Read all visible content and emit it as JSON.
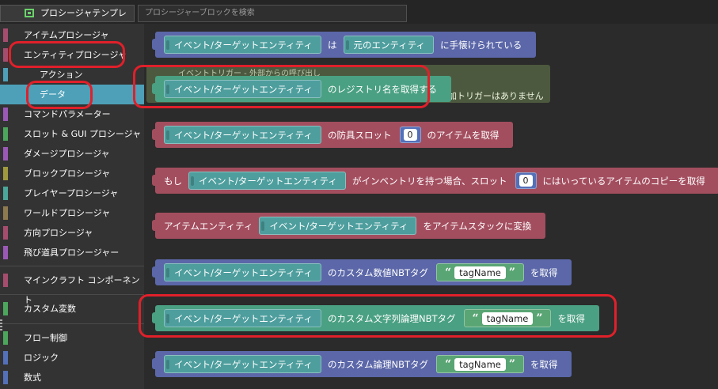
{
  "header": {
    "tab_label": "プロシージャテンプレート",
    "search_placeholder": "プロシージャーブロックを検索"
  },
  "sidebar": {
    "items": [
      {
        "label": "アイテムプロシージャ",
        "color": "#a64d6e"
      },
      {
        "label": "エンティティプロシージャ",
        "color": "#a64d6e"
      },
      {
        "label": "アクション",
        "color": "#4da0b8"
      },
      {
        "label": "データ",
        "color": "#4da0b8"
      },
      {
        "label": "コマンドパラメーター",
        "color": "#9b59b6"
      },
      {
        "label": "スロット & GUI プロシージャ",
        "color": "#4ca65c"
      },
      {
        "label": "ダメージプロシージャ",
        "color": "#9b59b6"
      },
      {
        "label": "ブロックプロシージャ",
        "color": "#9f9a3d"
      },
      {
        "label": "プレイヤープロシージャ",
        "color": "#4aa79a"
      },
      {
        "label": "ワールドプロシージャ",
        "color": "#8e7a4f"
      },
      {
        "label": "方向プロシージャ",
        "color": "#a64d6e"
      },
      {
        "label": "飛び道具プロシージャー",
        "color": "#9b59b6"
      },
      {
        "label": "マインクラフト コンポーネント",
        "color": "#a64d6e"
      },
      {
        "label": "カスタム変数",
        "color": "#4ca65c"
      },
      {
        "label": "フロー制御",
        "color": "#4ca65c"
      },
      {
        "label": "ロジック",
        "color": "#5470b8"
      },
      {
        "label": "数式",
        "color": "#5470b8"
      }
    ]
  },
  "workspace": {
    "ghost_text": "イベントトリガー - 外部からの呼び出し",
    "ghost_trailing": "追加トリガーはありません",
    "entity_label": "イベント/ターゲットエンティティ",
    "b1": {
      "mid": "は",
      "orig": "元のエンティティ",
      "end": "に手懐けられている"
    },
    "b2": {
      "end": "のレジストリ名を取得する"
    },
    "b3": {
      "mid": "の防具スロット",
      "num": "0",
      "end": "のアイテムを取得"
    },
    "b4": {
      "pre": "もし",
      "mid": "がインベントリを持つ場合、スロット",
      "num": "0",
      "end": "にはいっているアイテムのコピーを取得"
    },
    "b5": {
      "pre": "アイテムエンティティ",
      "end": "をアイテムスタックに変換"
    },
    "b6": {
      "mid": "のカスタム数値NBTタグ",
      "tag": "tagName",
      "end": "を取得"
    },
    "b7": {
      "mid": "のカスタム文字列論理NBTタグ",
      "tag": "tagName",
      "end": "を取得"
    },
    "b8": {
      "mid": "のカスタム論理NBTタグ",
      "tag": "tagName",
      "end": "を取得"
    },
    "quote_open": "“",
    "quote_close": "”"
  },
  "colors": {
    "entity_block": "#4e9e9e",
    "logic_block": "#5b67a8",
    "item_block": "#a34e5f",
    "selected_category": "#4da0b8",
    "highlight": "#e0202a"
  }
}
